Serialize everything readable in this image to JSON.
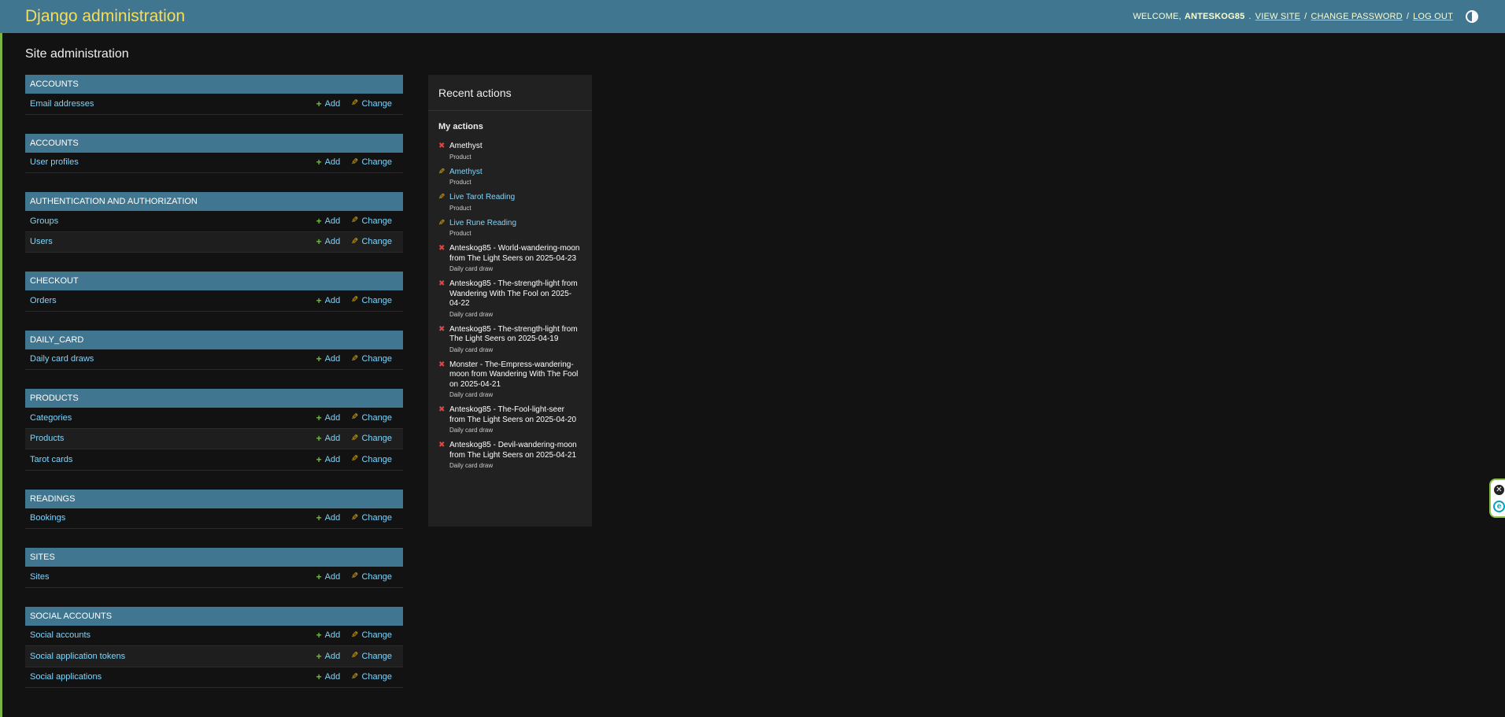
{
  "header": {
    "brand": "Django administration",
    "welcome": "Welcome,",
    "username": "ANTESKOG85",
    "view_site": "View site",
    "change_password": "Change password",
    "log_out": "Log out",
    "separator": "/"
  },
  "page_title": "Site administration",
  "labels": {
    "add": "Add",
    "change": "Change"
  },
  "modules": [
    {
      "title": "Accounts",
      "rows": [
        "Email addresses"
      ]
    },
    {
      "title": "Accounts",
      "rows": [
        "User profiles"
      ]
    },
    {
      "title": "Authentication and Authorization",
      "rows": [
        "Groups",
        "Users"
      ]
    },
    {
      "title": "Checkout",
      "rows": [
        "Orders"
      ]
    },
    {
      "title": "Daily_Card",
      "rows": [
        "Daily card draws"
      ]
    },
    {
      "title": "Products",
      "rows": [
        "Categories",
        "Products",
        "Tarot cards"
      ]
    },
    {
      "title": "Readings",
      "rows": [
        "Bookings"
      ]
    },
    {
      "title": "Sites",
      "rows": [
        "Sites"
      ]
    },
    {
      "title": "Social Accounts",
      "rows": [
        "Social accounts",
        "Social application tokens",
        "Social applications"
      ]
    }
  ],
  "recent": {
    "title": "Recent actions",
    "subtitle": "My actions",
    "actions": [
      {
        "kind": "deletion",
        "name": "Amethyst",
        "type": "Product"
      },
      {
        "kind": "change",
        "name": "Amethyst",
        "type": "Product"
      },
      {
        "kind": "change",
        "name": "Live Tarot Reading",
        "type": "Product"
      },
      {
        "kind": "change",
        "name": "Live Rune Reading",
        "type": "Product"
      },
      {
        "kind": "deletion",
        "name": "Anteskog85 - World-wandering-moon from The Light Seers on 2025-04-23",
        "type": "Daily card draw"
      },
      {
        "kind": "deletion",
        "name": "Anteskog85 - The-strength-light from Wandering With The Fool on 2025-04-22",
        "type": "Daily card draw"
      },
      {
        "kind": "deletion",
        "name": "Anteskog85 - The-strength-light from The Light Seers on 2025-04-19",
        "type": "Daily card draw"
      },
      {
        "kind": "deletion",
        "name": "Monster - The-Empress-wandering-moon from Wandering With The Fool on 2025-04-21",
        "type": "Daily card draw"
      },
      {
        "kind": "deletion",
        "name": "Anteskog85 - The-Fool-light-seer from The Light Seers on 2025-04-20",
        "type": "Daily card draw"
      },
      {
        "kind": "deletion",
        "name": "Anteskog85 - Devil-wandering-moon from The Light Seers on 2025-04-21",
        "type": "Daily card draw"
      }
    ]
  },
  "icons": {
    "deletion": "delete-x-icon",
    "change": "pencil-icon",
    "add": "plus-icon",
    "theme": "theme-toggle-icon"
  },
  "colors": {
    "header_bg": "#417690",
    "brand": "#f5dd5d",
    "link": "#81d4fa",
    "add_icon": "#70bf2b",
    "change_icon": "#efb80b",
    "delete_icon": "#dd4646",
    "background": "#121212"
  }
}
